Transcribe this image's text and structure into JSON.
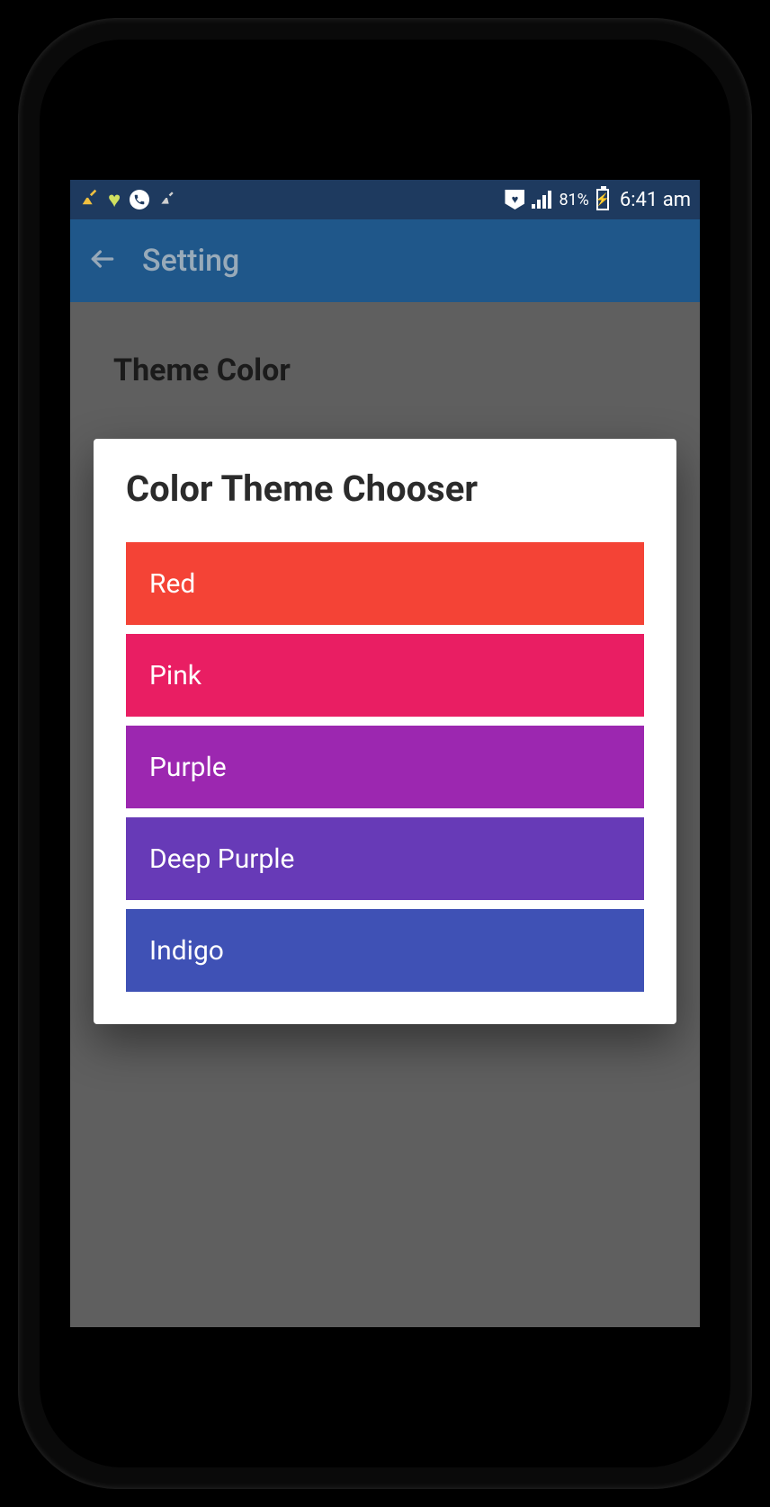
{
  "statusbar": {
    "battery_percent": "81%",
    "time": "6:41 am"
  },
  "appbar": {
    "title": "Setting"
  },
  "page": {
    "section_heading": "Theme Color"
  },
  "dialog": {
    "title": "Color Theme Chooser",
    "options": [
      {
        "label": "Red",
        "color": "#f44336"
      },
      {
        "label": "Pink",
        "color": "#e91e63"
      },
      {
        "label": "Purple",
        "color": "#9c27b0"
      },
      {
        "label": "Deep Purple",
        "color": "#673ab7"
      },
      {
        "label": "Indigo",
        "color": "#3f51b5"
      }
    ]
  }
}
